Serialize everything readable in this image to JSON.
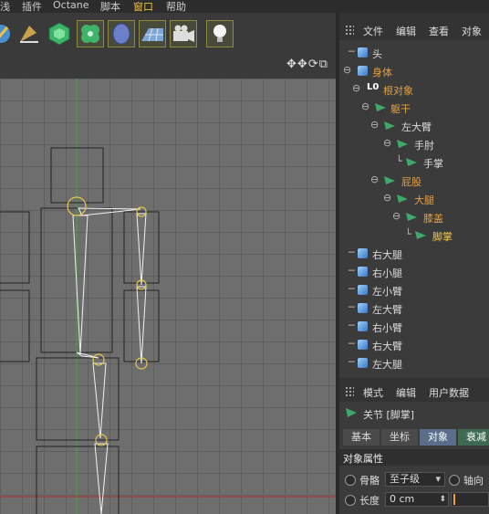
{
  "menu": [
    "浅",
    "插件",
    "Octane",
    "脚本",
    "窗口",
    "帮助"
  ],
  "menu_active_index": 4,
  "toolbar_icons": [
    "brush-icon",
    "pen-tool-icon",
    "cube-gem-icon",
    "clover-deformer-icon",
    "blob-shader-icon",
    "grid-floor-icon",
    "camera-icon",
    "light-bulb-icon"
  ],
  "viewport_nav": "✥✥⟳⧉",
  "object_manager": {
    "tabs": [
      "文件",
      "编辑",
      "查看",
      "对象"
    ],
    "tree": [
      {
        "label": "头",
        "type": "cube",
        "color": "normal"
      },
      {
        "label": "身体",
        "type": "cube",
        "color": "orange"
      },
      {
        "label": "根对象",
        "type": "null",
        "color": "orange"
      },
      {
        "label": "躯干",
        "type": "bone",
        "color": "orange"
      },
      {
        "label": "左大臂",
        "type": "bone",
        "color": "normal"
      },
      {
        "label": "手肘",
        "type": "bone",
        "color": "normal"
      },
      {
        "label": "手掌",
        "type": "bone",
        "color": "normal"
      },
      {
        "label": "屁股",
        "type": "bone",
        "color": "orange"
      },
      {
        "label": "大腿",
        "type": "bone",
        "color": "orange"
      },
      {
        "label": "膝盖",
        "type": "bone",
        "color": "orange"
      },
      {
        "label": "脚掌",
        "type": "bone",
        "color": "yellow"
      },
      {
        "label": "右大腿",
        "type": "cube",
        "color": "normal"
      },
      {
        "label": "右小腿",
        "type": "cube",
        "color": "normal"
      },
      {
        "label": "左小臂",
        "type": "cube",
        "color": "normal"
      },
      {
        "label": "左大臂",
        "type": "cube",
        "color": "normal"
      },
      {
        "label": "右小臂",
        "type": "cube",
        "color": "normal"
      },
      {
        "label": "右大臂",
        "type": "cube",
        "color": "normal"
      },
      {
        "label": "左大腿",
        "type": "cube",
        "color": "normal"
      }
    ]
  },
  "attribute_manager": {
    "tabs": [
      "模式",
      "编辑",
      "用户数据"
    ],
    "title": "关节 [脚掌]",
    "prop_tabs": [
      "基本",
      "坐标",
      "对象",
      "衰减"
    ],
    "selected_prop_tab": "对象",
    "section": "对象属性",
    "bone_label": "骨骼",
    "bone_value": "至子级",
    "axis_label": "轴向",
    "length_label": "长度",
    "length_value": "0 cm"
  },
  "colors": {
    "orange": "#e6a040",
    "yellow": "#f2c94c",
    "green_axis": "#3fa83f",
    "red_axis": "#b03030"
  }
}
